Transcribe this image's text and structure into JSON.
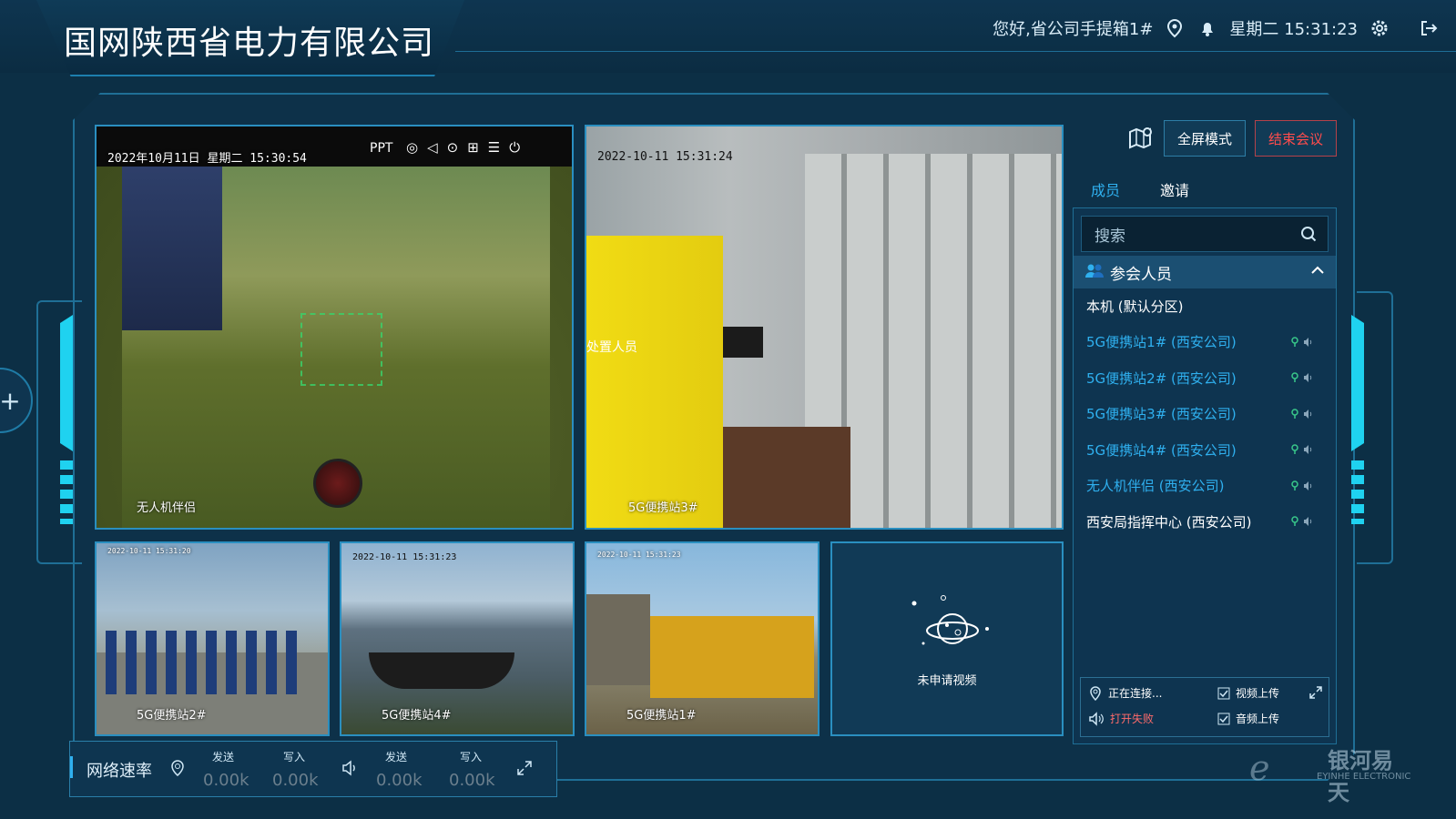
{
  "header": {
    "title": "国网陕西省电力有限公司",
    "greeting": "您好,省公司手提箱1#",
    "datetime": "星期二 15:31:23"
  },
  "videos": {
    "main_left": {
      "time": "2022年10月11日 星期二 15:30:54",
      "label": "无人机伴侣",
      "ppt": "PPT"
    },
    "main_right": {
      "time": "2022-10-11 15:31:24",
      "label": "5G便携站3#",
      "vest": "处置人员"
    },
    "small": [
      {
        "time": "2022-10-11 15:31:20",
        "label": "5G便携站2#"
      },
      {
        "time": "2022-10-11 15:31:23",
        "label": "5G便携站4#"
      },
      {
        "time": "2022-10-11 15:31:23",
        "label": "5G便携站1#"
      }
    ],
    "no_video_text": "未申请视频"
  },
  "right_panel": {
    "fullscreen_label": "全屏模式",
    "end_meeting_label": "结束会议",
    "tabs": [
      "成员",
      "邀请"
    ],
    "search_placeholder": "搜索",
    "section_title": "参会人员",
    "members": [
      {
        "name": "本机 (默认分区)",
        "color": "#ffffff",
        "show_status": false
      },
      {
        "name": "5G便携站1# (西安公司)",
        "color": "#2fb0ef",
        "show_status": true
      },
      {
        "name": "5G便携站2# (西安公司)",
        "color": "#2fb0ef",
        "show_status": true
      },
      {
        "name": "5G便携站3# (西安公司)",
        "color": "#2fb0ef",
        "show_status": true
      },
      {
        "name": "5G便携站4# (西安公司)",
        "color": "#2fb0ef",
        "show_status": true
      },
      {
        "name": "无人机伴侣 (西安公司)",
        "color": "#2fb0ef",
        "show_status": true
      },
      {
        "name": "西安局指挥中心 (西安公司)",
        "color": "#ffffff",
        "show_status": true
      }
    ],
    "controls": {
      "connecting": "正在连接...",
      "video_upload": "视频上传",
      "open_failed": "打开失败",
      "audio_upload": "音频上传"
    }
  },
  "network": {
    "label": "网络速率",
    "send_label": "发送",
    "write_label": "写入",
    "video_send": "0.00k",
    "video_write": "0.00k",
    "audio_send": "0.00k",
    "audio_write": "0.00k"
  },
  "watermark": {
    "brand": "银河易天",
    "sub": "EYINHE ELECTRONIC"
  },
  "colors": {
    "accent": "#2fb0ef",
    "danger": "#ff4c4c",
    "border": "#2a8fc0"
  }
}
